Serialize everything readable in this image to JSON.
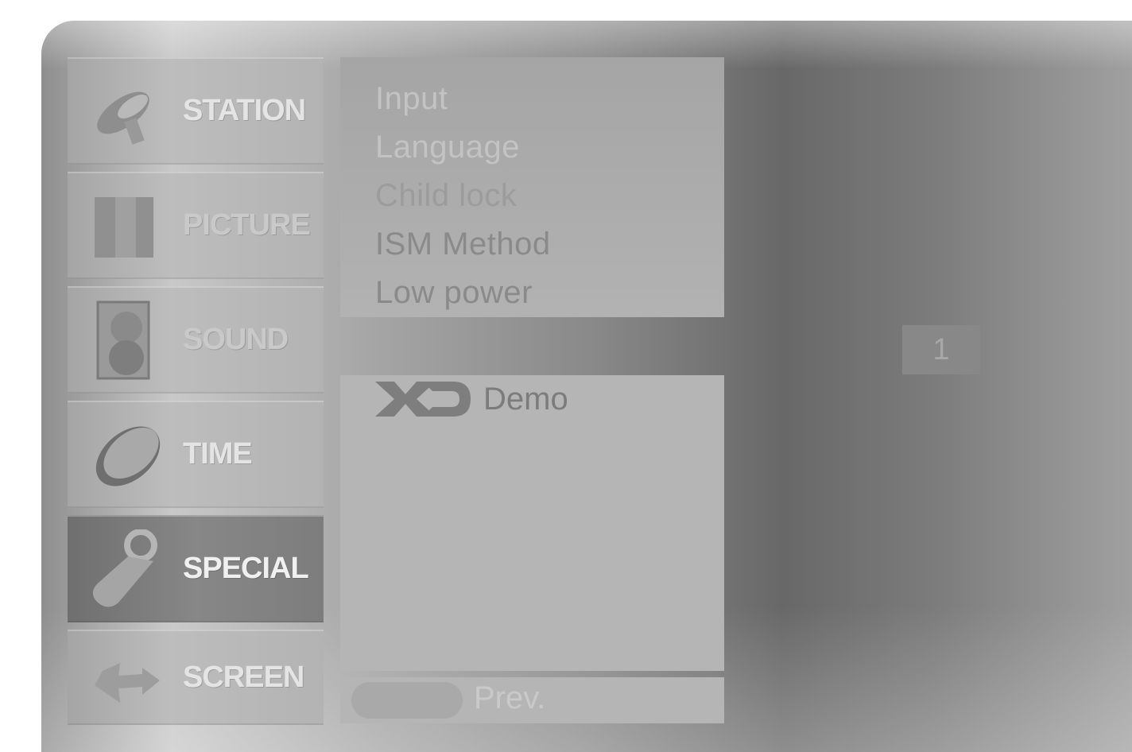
{
  "categories": [
    {
      "label": "STATION",
      "icon": "satellite-dish-icon"
    },
    {
      "label": "PICTURE",
      "icon": "picture-screen-icon"
    },
    {
      "label": "SOUND",
      "icon": "speaker-icon"
    },
    {
      "label": "TIME",
      "icon": "clock-icon"
    },
    {
      "label": "SPECIAL",
      "icon": "key-tag-icon",
      "selected": true
    },
    {
      "label": "SCREEN",
      "icon": "move-arrows-icon"
    }
  ],
  "submenu": {
    "items": [
      "Input",
      "Language",
      "Child lock",
      "ISM Method",
      "Low power"
    ],
    "demo": {
      "logo": "XD",
      "label": "Demo"
    }
  },
  "footer": {
    "prev_label": "Prev."
  },
  "page_indicator": "1",
  "colors": {
    "selected_category": "#7d7d7d",
    "panel": "#b5b5b5"
  }
}
